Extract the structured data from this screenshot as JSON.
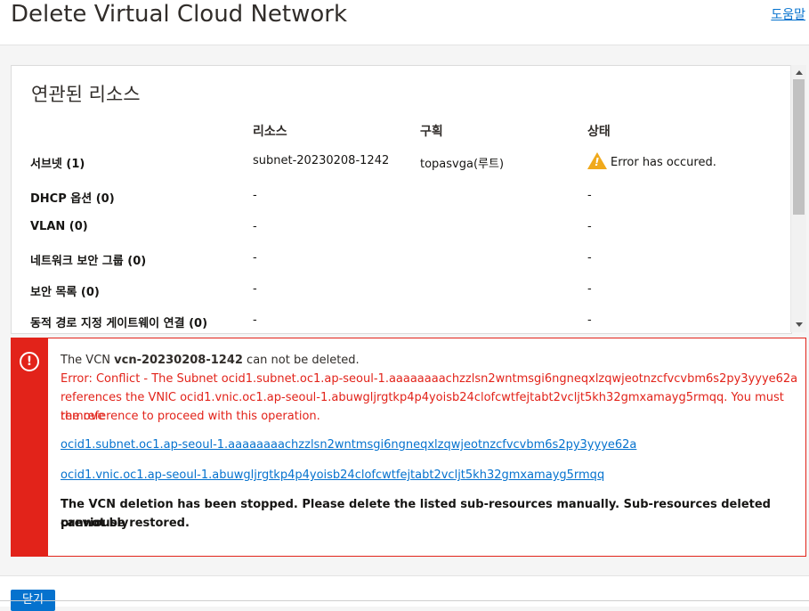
{
  "header": {
    "title": "Delete Virtual Cloud Network",
    "help_label": "도움말"
  },
  "resources": {
    "title": "연관된 리소스",
    "columns": [
      "리소스",
      "구획",
      "상태"
    ],
    "rows": [
      {
        "label": "서브넷 (1)",
        "resource": "subnet-20230208-1242",
        "compartment": "topasvga(루트)",
        "status": "Error has occured.",
        "status_icon": "warning-icon"
      },
      {
        "label": "DHCP 옵션 (0)",
        "resource": "-",
        "compartment": "",
        "status": "-"
      },
      {
        "label": "VLAN (0)",
        "resource": "-",
        "compartment": "",
        "status": "-"
      },
      {
        "label": "네트워크 보안 그룹 (0)",
        "resource": "-",
        "compartment": "",
        "status": "-"
      },
      {
        "label": "보안 목록 (0)",
        "resource": "-",
        "compartment": "",
        "status": "-"
      },
      {
        "label": "동적 경로 지정 게이트웨이 연결 (0)",
        "resource": "-",
        "compartment": "",
        "status": "-"
      }
    ]
  },
  "error": {
    "line1_prefix": "The VCN ",
    "line1_vcn": "vcn-20230208-1242",
    "line1_suffix": " can not be deleted.",
    "detail_1": "Error: Conflict - The Subnet ocid1.subnet.oc1.ap-seoul-1.aaaaaaaachzzlsn2wntmsgi6ngneqxlzqwjeotnzcfvcvbm6s2py3yyye62a",
    "detail_2": "references the VNIC ocid1.vnic.oc1.ap-seoul-1.abuwgljrgtkp4p4yoisb24clofcwtfejtabt2vcljt5kh32gmxamayg5rmqq. You must remove",
    "detail_3": "the reference to proceed with this operation.",
    "link_subnet": "ocid1.subnet.oc1.ap-seoul-1.aaaaaaaachzzlsn2wntmsgi6ngneqxlzqwjeotnzcfvcvbm6s2py3yyye62a",
    "link_vnic": "ocid1.vnic.oc1.ap-seoul-1.abuwgljrgtkp4p4yoisb24clofcwtfejtabt2vcljt5kh32gmxamayg5rmqq",
    "stopped_1": "The VCN deletion has been stopped. Please delete the listed sub-resources manually. Sub-resources deleted previously",
    "stopped_2": "cannot be restored."
  },
  "footer": {
    "close_label": "닫기"
  },
  "colors": {
    "error_red": "#e2231a",
    "link_blue": "#0572ce",
    "warning_orange": "#f0a91b"
  }
}
